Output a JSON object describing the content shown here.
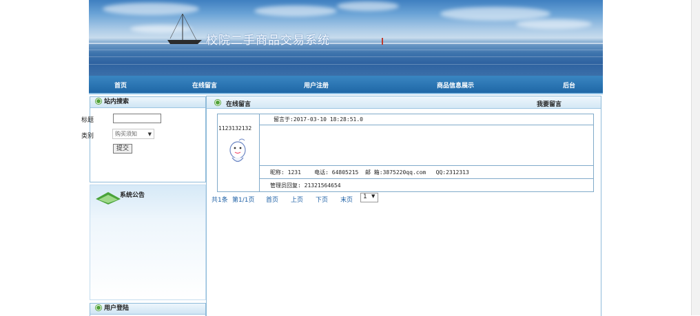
{
  "site": {
    "title": "校院二手商品交易系统"
  },
  "nav": {
    "items": [
      "首页",
      "在线留言",
      "用户注册",
      "商品信息展示",
      "后台"
    ]
  },
  "search": {
    "title": "站内搜索",
    "title_label": "标题",
    "category_label": "类别",
    "category_value": "购买须知",
    "submit_label": "提交"
  },
  "notice": {
    "title": "系统公告"
  },
  "login": {
    "title": "用户登陆"
  },
  "guestbook": {
    "title": "在线留言",
    "write_link": "我要留言",
    "message": {
      "time": "留言于:2017-03-10 18:28:51.0",
      "content": "1123132132",
      "info": "昵称: 1231    电话: 64805215  邮 箱:3875220qq.com   QQ:2312313",
      "reply": "管理员回复: 21321564654"
    }
  },
  "pager": {
    "total": "共1条",
    "page": "第1/1页",
    "first": "首页",
    "prev": "上页",
    "next": "下页",
    "last": "末页",
    "current": "1"
  },
  "colors": {
    "nav": "#1f67a6",
    "accent_dot": "#53a33a",
    "link": "#1c5fa5"
  }
}
